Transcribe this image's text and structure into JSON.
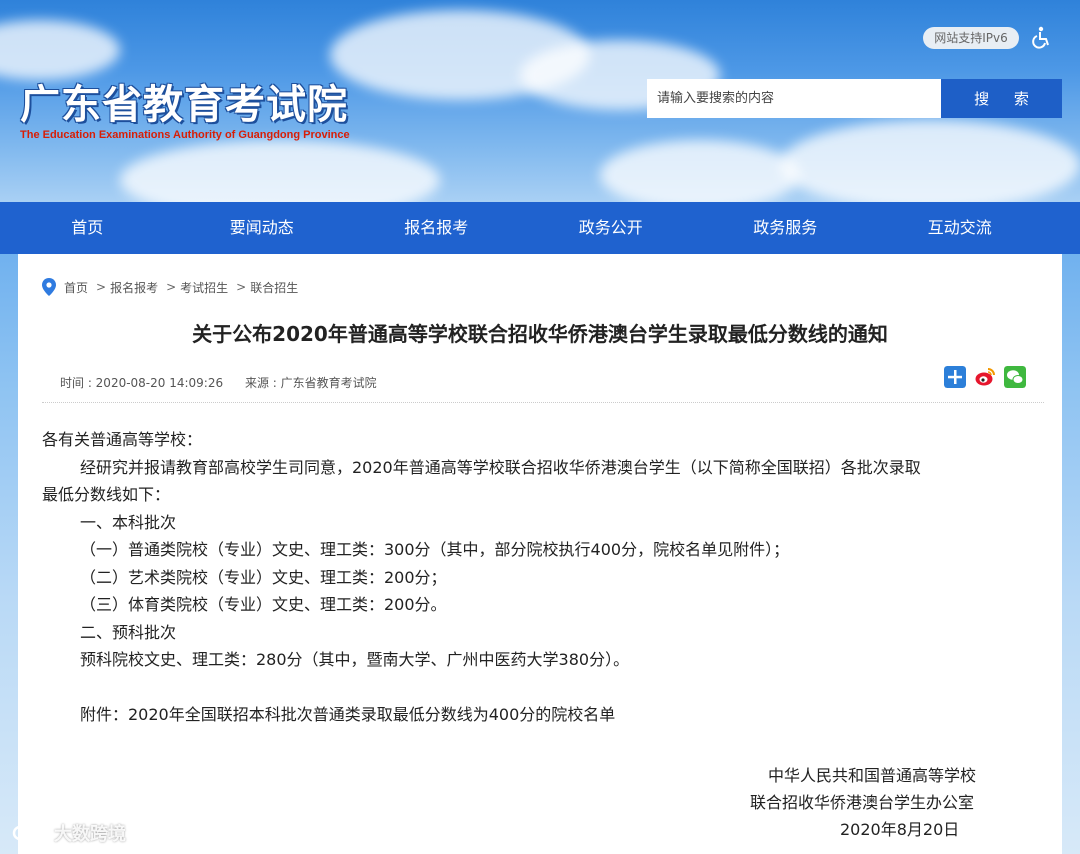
{
  "header": {
    "logo_cn": "广东省教育考试院",
    "logo_en": "The Education Examinations Authority of Guangdong Province",
    "ipv6_badge": "网站支持IPv6",
    "accessibility_icon": "wheelchair-icon",
    "search": {
      "placeholder": "请输入要搜索的内容",
      "button_label": "搜 索"
    }
  },
  "nav": {
    "items": [
      "首页",
      "要闻动态",
      "报名报考",
      "政务公开",
      "政务服务",
      "互动交流"
    ]
  },
  "breadcrumb": {
    "icon": "location-pin-icon",
    "items": [
      "首页",
      "报名报考",
      "考试招生",
      "联合招生"
    ],
    "separator": ">"
  },
  "article": {
    "title": "关于公布2020年普通高等学校联合招收华侨港澳台学生录取最低分数线的通知",
    "time": "时间 : 2020-08-20 14:09:26",
    "source": "来源 : 广东省教育考试院",
    "share_icons": [
      "plus-share-icon",
      "weibo-icon",
      "wechat-icon"
    ],
    "greeting": "各有关普通高等学校：",
    "intro_line1": "经研究并报请教育部高校学生司同意，2020年普通高等学校联合招收华侨港澳台学生（以下简称全国联招）各批次录取",
    "intro_line2": "最低分数线如下：",
    "section1": "一、本科批次",
    "item1": "（一）普通类院校（专业）文史、理工类：300分（其中，部分院校执行400分，院校名单见附件）；",
    "item2": "（二）艺术类院校（专业）文史、理工类：200分；",
    "item3": "（三）体育类院校（专业）文史、理工类：200分。",
    "section2": "二、预科批次",
    "item4": "预科院校文史、理工类：280分（其中，暨南大学、广州中医药大学380分）。",
    "attachment": "附件：2020年全国联招本科批次普通类录取最低分数线为400分的院校名单",
    "sign1": "中华人民共和国普通高等学校",
    "sign2": "联合招收华侨港澳台学生办公室",
    "date": "2020年8月20日"
  },
  "watermark": "大数跨境",
  "colors": {
    "nav_bg": "#1f62cf",
    "search_btn": "#1e5fc7",
    "logo_en": "#d81e06"
  }
}
